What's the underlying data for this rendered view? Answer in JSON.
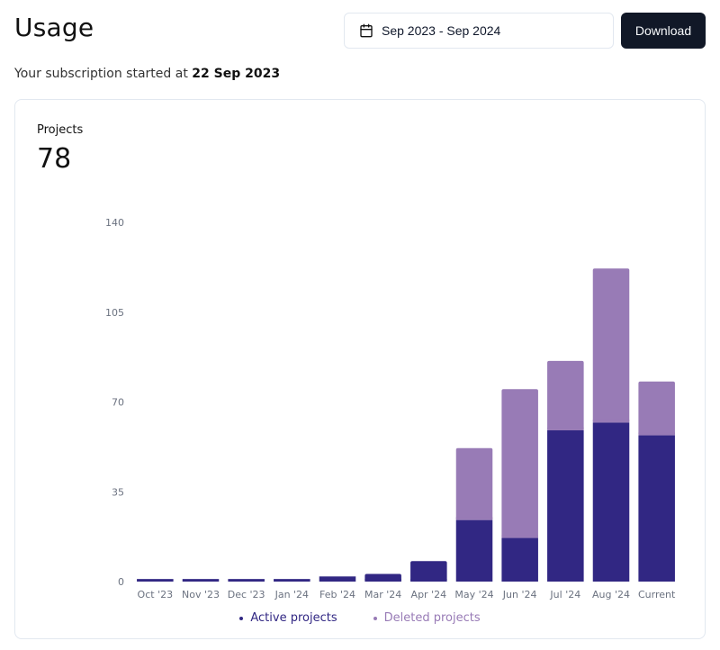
{
  "header": {
    "title": "Usage",
    "date_range": "Sep 2023 - Sep 2024",
    "date_icon": "calendar-icon",
    "download_label": "Download"
  },
  "subscription": {
    "prefix": "Your subscription started at ",
    "date": "22 Sep 2023"
  },
  "card": {
    "label": "Projects",
    "value": "78"
  },
  "colors": {
    "active": "#312783",
    "deleted": "#987bb6",
    "button_bg": "#111827"
  },
  "chart_data": {
    "type": "bar",
    "stacked": true,
    "title": "Projects",
    "xlabel": "",
    "ylabel": "",
    "categories": [
      "Oct '23",
      "Nov '23",
      "Dec '23",
      "Jan '24",
      "Feb '24",
      "Mar '24",
      "Apr '24",
      "May '24",
      "Jun '24",
      "Jul '24",
      "Aug '24",
      "Current"
    ],
    "series": [
      {
        "name": "Active projects",
        "color": "#312783",
        "values": [
          1,
          1,
          1,
          1,
          2,
          3,
          8,
          24,
          17,
          59,
          62,
          57
        ]
      },
      {
        "name": "Deleted projects",
        "color": "#987bb6",
        "values": [
          0,
          0,
          0,
          0,
          0,
          0,
          0,
          28,
          58,
          27,
          60,
          21
        ]
      }
    ],
    "ylim": [
      0,
      140
    ],
    "yticks": [
      0,
      35,
      70,
      105,
      140
    ],
    "grid": false,
    "legend": "bottom-center"
  }
}
